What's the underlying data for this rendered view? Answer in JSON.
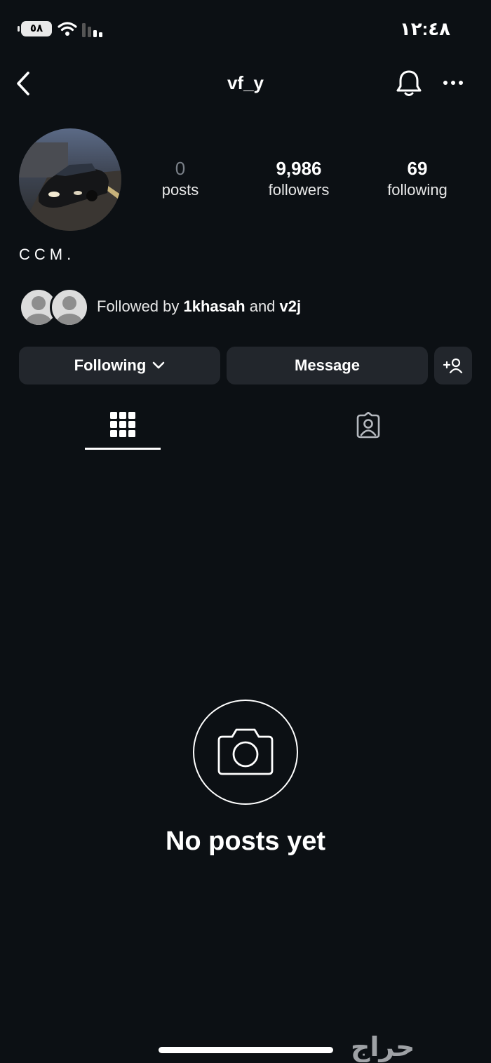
{
  "status_bar": {
    "time": "١٢:٤٨",
    "battery": "٥٨"
  },
  "header": {
    "username": "vf_y"
  },
  "profile": {
    "stats": [
      {
        "value": "0",
        "label": "posts"
      },
      {
        "value": "9,986",
        "label": "followers"
      },
      {
        "value": "69",
        "label": "following"
      }
    ],
    "bio": "CCM."
  },
  "mutual": {
    "prefix": "Followed by",
    "user1": "1khasah",
    "conjunction": "and",
    "user2": "v2j"
  },
  "actions": {
    "following_label": "Following",
    "message_label": "Message"
  },
  "empty_state": {
    "title": "No posts yet"
  },
  "watermark": {
    "text": "حراج"
  }
}
